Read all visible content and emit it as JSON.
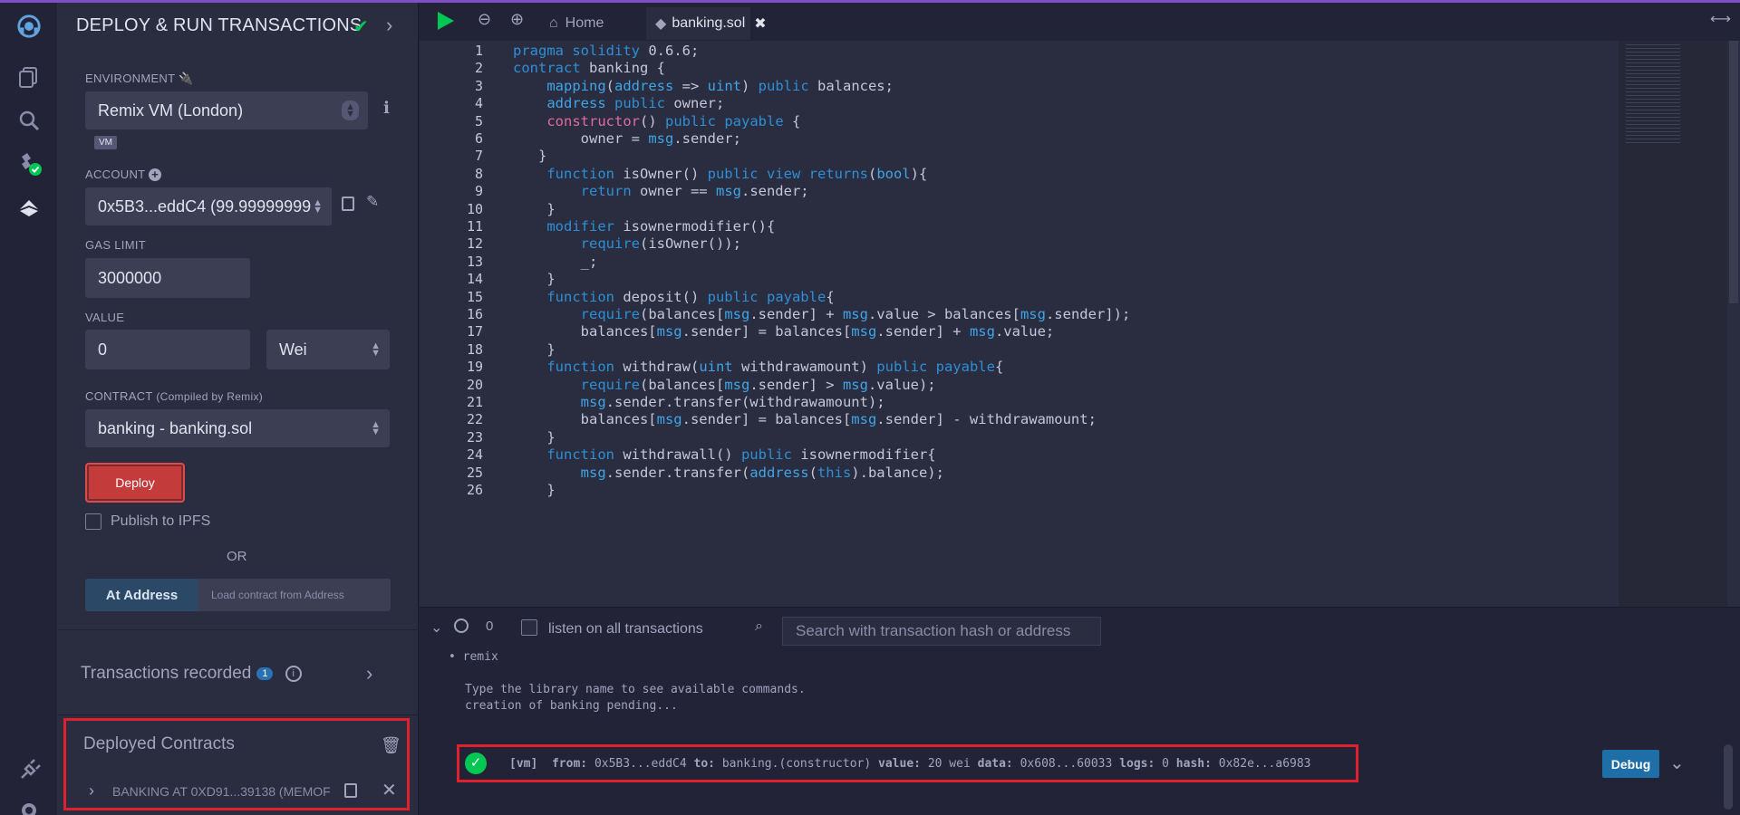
{
  "panel": {
    "title": "DEPLOY & RUN TRANSACTIONS",
    "environment_label": "ENVIRONMENT",
    "environment_value": "Remix VM (London)",
    "vm_badge": "VM",
    "account_label": "ACCOUNT",
    "account_value": "0x5B3...eddC4 (99.99999999",
    "gas_label": "GAS LIMIT",
    "gas_value": "3000000",
    "value_label": "VALUE",
    "value_value": "0",
    "value_unit": "Wei",
    "contract_label": "CONTRACT",
    "contract_sub": "(Compiled by Remix)",
    "contract_value": "banking - banking.sol",
    "deploy_label": "Deploy",
    "publish_label": "Publish to IPFS",
    "or_label": "OR",
    "at_address_label": "At Address",
    "load_placeholder": "Load contract from Address",
    "tx_recorded_label": "Transactions recorded",
    "tx_recorded_count": "1",
    "deployed_label": "Deployed Contracts",
    "deployed_item": "BANKING AT 0XD91...39138 (MEMOF"
  },
  "tabs": {
    "home": "Home",
    "file": "banking.sol"
  },
  "code_lines": [
    "1",
    "2",
    "3",
    "4",
    "5",
    "6",
    "7",
    "8",
    "9",
    "10",
    "11",
    "12",
    "13",
    "14",
    "15",
    "16",
    "17",
    "18",
    "19",
    "20",
    "21",
    "22",
    "23",
    "24",
    "25",
    "26"
  ],
  "terminal": {
    "count": "0",
    "listen_label": "listen on all transactions",
    "search_placeholder": "Search with transaction hash or address",
    "bullet": "remix",
    "hint1": "Type the library name to see available commands.",
    "hint2": "creation of banking pending...",
    "tx_vm": "[vm]",
    "tx_from_label": "from:",
    "tx_from": "0x5B3...eddC4",
    "tx_to_label": "to:",
    "tx_to": "banking.(constructor)",
    "tx_value_label": "value:",
    "tx_value": "20 wei",
    "tx_data_label": "data:",
    "tx_data": "0x608...60033",
    "tx_logs_label": "logs:",
    "tx_logs": "0",
    "tx_hash_label": "hash:",
    "tx_hash": "0x82e...a6983",
    "debug_label": "Debug"
  }
}
